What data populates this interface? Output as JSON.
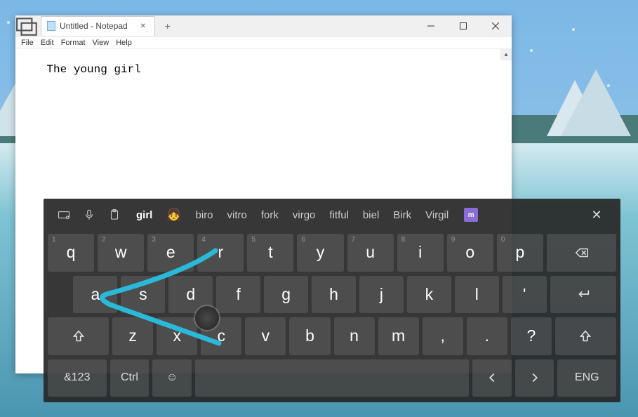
{
  "notepad": {
    "tab_title": "Untitled - Notepad",
    "menus": [
      "File",
      "Edit",
      "Format",
      "View",
      "Help"
    ],
    "content": "The young girl"
  },
  "keyboard": {
    "suggestions": [
      "girl",
      "biro",
      "vitro",
      "fork",
      "virgo",
      "fitful",
      "biel",
      "Birk",
      "Virgil"
    ],
    "suggestion_emoji": "👧",
    "active_suggestion_index": 0,
    "row1": [
      {
        "main": "q",
        "sup": "1"
      },
      {
        "main": "w",
        "sup": "2"
      },
      {
        "main": "e",
        "sup": "3"
      },
      {
        "main": "r",
        "sup": "4"
      },
      {
        "main": "t",
        "sup": "5"
      },
      {
        "main": "y",
        "sup": "6"
      },
      {
        "main": "u",
        "sup": "7"
      },
      {
        "main": "i",
        "sup": "8"
      },
      {
        "main": "o",
        "sup": "9"
      },
      {
        "main": "p",
        "sup": "0"
      }
    ],
    "row2": [
      "a",
      "s",
      "d",
      "f",
      "g",
      "h",
      "j",
      "k",
      "l",
      "'"
    ],
    "row3": [
      "z",
      "x",
      "c",
      "v",
      "b",
      "n",
      "m",
      ",",
      ".",
      "?"
    ],
    "bottom": {
      "numlabel": "&123",
      "ctrl": "Ctrl",
      "lang": "ENG"
    }
  }
}
